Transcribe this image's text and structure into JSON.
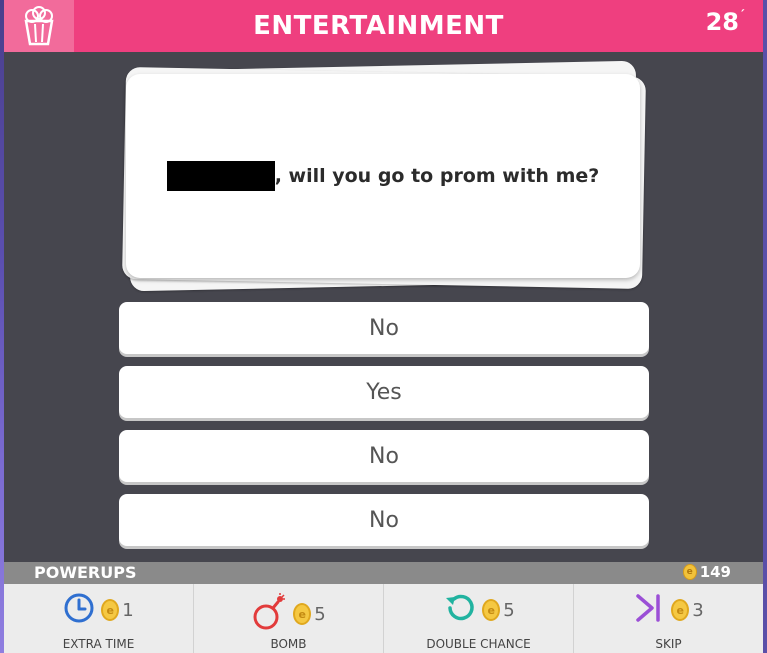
{
  "header": {
    "category": "ENTERTAINMENT",
    "timer": "28",
    "color": "#ef3f7f",
    "icon": "popcorn-icon"
  },
  "question": {
    "text": ", will you go to prom with me?"
  },
  "answers": [
    "No",
    "Yes",
    "No",
    "No"
  ],
  "powerups": {
    "title": "POWERUPS",
    "coins": "149",
    "items": [
      {
        "label": "EXTRA TIME",
        "cost": "1",
        "icon": "clock-icon",
        "color": "#2f6fd0"
      },
      {
        "label": "BOMB",
        "cost": "5",
        "icon": "bomb-icon",
        "color": "#e23b3b"
      },
      {
        "label": "DOUBLE CHANCE",
        "cost": "5",
        "icon": "rotate-icon",
        "color": "#21b3a0"
      },
      {
        "label": "SKIP",
        "cost": "3",
        "icon": "skip-icon",
        "color": "#9b4fd6"
      }
    ]
  }
}
